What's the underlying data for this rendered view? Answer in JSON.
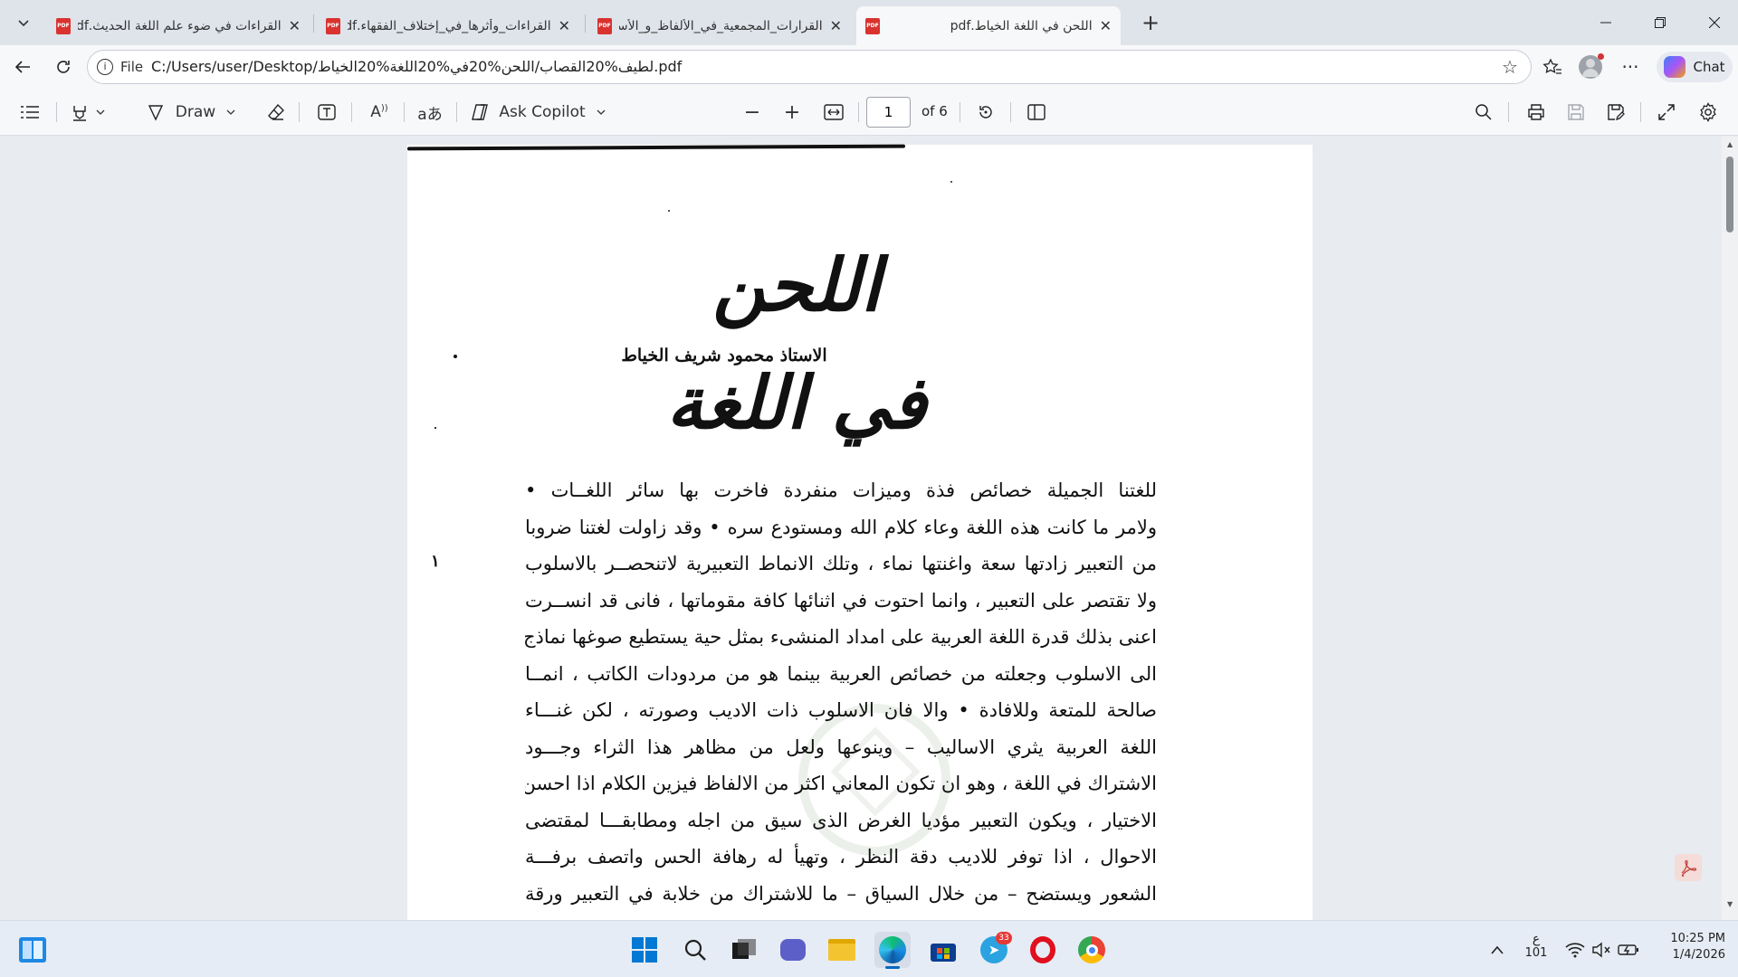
{
  "tabs": [
    {
      "title": "القراءات في ضوء علم اللغة الحديث.pdf",
      "icon": "pdf-icon",
      "active": false
    },
    {
      "title": "القراءات_وأثرها_في_إختلاف_الفقهاء.pdf",
      "icon": "pdf-icon",
      "active": false
    },
    {
      "title": "القرارات_المجمعية_في_الألفاظ_و_الأساليب.pdf",
      "icon": "pdf-icon",
      "active": false
    },
    {
      "title": "اللحن في اللغة الخياط.pdf",
      "icon": "pdf-icon",
      "active": true
    }
  ],
  "pdf_badge": "PDF",
  "address": {
    "scheme_label": "File",
    "url": "C:/Users/user/Desktop/لطيف%20القصاب/اللحن%20في%20اللغة%20الخياط.pdf"
  },
  "copilot": {
    "chat_label": "Chat"
  },
  "pdf_toolbar": {
    "draw_label": "Draw",
    "ask_copilot_label": "Ask Copilot",
    "page_number": "1",
    "page_total": "of 6"
  },
  "document": {
    "title": "اللحن في اللغة",
    "author": "الاستاذ محمود شريف الخياط",
    "lines": [
      "للغتنا الجميلة خصائص فذة وميزات منفردة فاخرت بها سائر اللغــات •",
      "ولامر ما كانت هذه اللغة وعاء كلام الله ومستودع سره • وقد زاولت لغتنا ضروبا",
      "من التعبير زادتها سعة واغنتها نماء ، وتلك الانماط التعبيرية لاتنحصــر بالاسلوب",
      "ولا تقتصر على التعبير ، وانما احتوت في اثنائها كافة مقوماتها ، فانى قد انســرت",
      "اعنى بذلك قدرة اللغة العربية على امداد المنشىء بمثل حية يستطيع صوغها نماذج",
      "الى الاسلوب وجعلته من خصائص العربية بينما هو من مردودات الكاتب ، انمــا",
      "صالحة للمتعة وللافادة • والا فان الاسلوب ذات الاديب وصورته ، لكن غنـــاء",
      "اللغة العربية يثري الاساليب – وينوعها ولعل من مظاهر هذا الثراء وجـــود",
      "الاشتراك في اللغة ، وهو ان تكون المعاني اكثر من الالفاظ فيزين الكلام اذا احسن",
      "الاختيار ، ويكون التعبير مؤديا الغرض الذى سيق من اجله ومطابقـــا لمقتضى",
      "الاحوال ، اذا توفر للاديب دقة النظر ، وتهيأ له رهافة الحس واتصف برفـــة",
      "الشعور ويستضح – من خلال السياق – ما للاشتراك من خلابة في التعبير ورقة"
    ],
    "margin_mark": "١"
  },
  "taskbar": {
    "keyboard_lang": "ع",
    "keyboard_num": "101",
    "time": "10:25 PM",
    "date": "1/4/2026",
    "telegram_badge": "33"
  },
  "colors": {
    "accent": "#0067c0",
    "pdf_red": "#d9322f",
    "tab_bg": "#dfe3ea",
    "toolbar_bg": "#f7f8fa",
    "page_bg": "#e8ebf0"
  }
}
